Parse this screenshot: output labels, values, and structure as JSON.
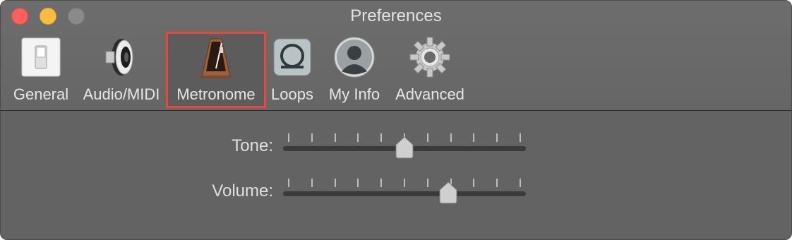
{
  "window": {
    "title": "Preferences"
  },
  "tabs": [
    {
      "id": "general",
      "label": "General",
      "icon": "switch-icon"
    },
    {
      "id": "audio-midi",
      "label": "Audio/MIDI",
      "icon": "speaker-icon"
    },
    {
      "id": "metronome",
      "label": "Metronome",
      "icon": "metronome-icon",
      "selected": true
    },
    {
      "id": "loops",
      "label": "Loops",
      "icon": "loop-icon"
    },
    {
      "id": "my-info",
      "label": "My Info",
      "icon": "user-avatar-icon"
    },
    {
      "id": "advanced",
      "label": "Advanced",
      "icon": "gear-icon"
    }
  ],
  "metronome": {
    "tone": {
      "label": "Tone:",
      "ticks": 11,
      "value": 0.5
    },
    "volume": {
      "label": "Volume:",
      "ticks": 11,
      "value": 0.69
    }
  },
  "colors": {
    "highlight": "#e8473d",
    "close": "#fc605c",
    "minimize": "#fdbc40",
    "zoom": "#8a8a8a"
  }
}
